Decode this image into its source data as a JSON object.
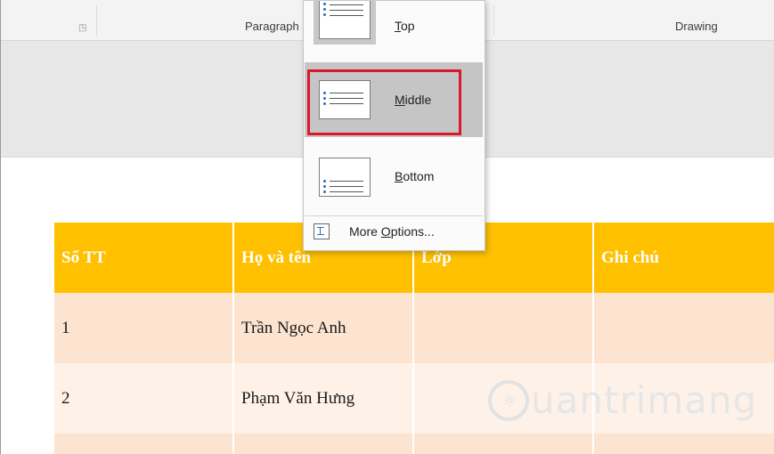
{
  "ribbon": {
    "launcher_glyph": "◳",
    "groups": {
      "paragraph": "Paragraph",
      "drawing": "Drawing"
    }
  },
  "align_menu": {
    "items": [
      {
        "label": "Top",
        "access_key": "T",
        "rest": "op"
      },
      {
        "label": "Middle",
        "access_key": "M",
        "rest": "iddle"
      },
      {
        "label": "Bottom",
        "access_key": "B",
        "rest": "ottom"
      }
    ],
    "more_options": {
      "label": "More Options...",
      "pre": "More ",
      "access_key": "O",
      "rest": "ptions..."
    },
    "selected": "Middle",
    "highlight_color": "#d9192b"
  },
  "table": {
    "headers": [
      "Số TT",
      "Họ và tên",
      "Lớp",
      "Ghi chú"
    ],
    "rows": [
      [
        "1",
        "Trần Ngọc Anh",
        "",
        ""
      ],
      [
        "2",
        "Phạm Văn Hưng",
        "",
        ""
      ]
    ],
    "header_color": "#ffc000",
    "odd_row_color": "#fce4d0",
    "even_row_color": "#fef2e8"
  },
  "watermark": {
    "icon_glyph": "☼",
    "text": "uantrimang"
  }
}
